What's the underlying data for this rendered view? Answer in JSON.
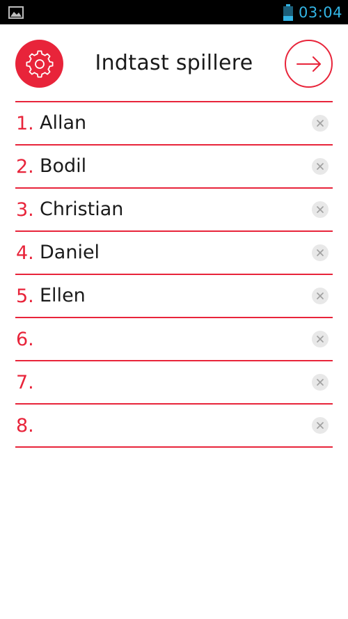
{
  "status_bar": {
    "time": "03:04",
    "left_icon": "gallery-icon",
    "battery_icon": "battery-icon",
    "time_color": "#33b5e5"
  },
  "header": {
    "title": "Indtast spillere",
    "settings_icon": "gear-icon",
    "next_icon": "arrow-right-icon"
  },
  "accent_color": "#e8243a",
  "players": [
    {
      "number": "1.",
      "name": "Allan"
    },
    {
      "number": "2.",
      "name": "Bodil"
    },
    {
      "number": "3.",
      "name": "Christian"
    },
    {
      "number": "4.",
      "name": "Daniel"
    },
    {
      "number": "5.",
      "name": "Ellen"
    },
    {
      "number": "6.",
      "name": ""
    },
    {
      "number": "7.",
      "name": ""
    },
    {
      "number": "8.",
      "name": ""
    }
  ],
  "clear_icon": "clear-icon"
}
